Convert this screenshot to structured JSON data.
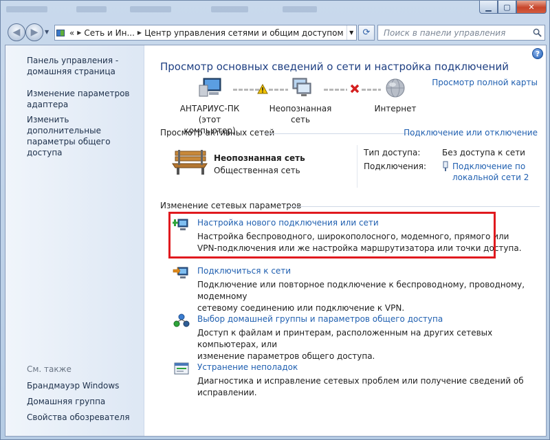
{
  "titlebar": {
    "minimize_icon": "minimize-icon",
    "maximize_icon": "maximize-icon",
    "close_icon": "close-icon"
  },
  "navbar": {
    "breadcrumbs": [
      "«",
      "Сеть и Ин...",
      "Центр управления сетями и общим доступом"
    ],
    "search_placeholder": "Поиск в панели управления"
  },
  "sidebar": {
    "links": [
      "Панель управления - домашняя страница",
      "Изменение параметров адаптера",
      "Изменить дополнительные параметры общего доступа"
    ],
    "see_also_label": "См. также",
    "see_also": [
      "Брандмауэр Windows",
      "Домашняя группа",
      "Свойства обозревателя"
    ]
  },
  "main": {
    "title": "Просмотр основных сведений о сети и настройка подключений",
    "full_map_link": "Просмотр полной карты",
    "map": {
      "computer": "АНТАРИУС-ПК",
      "computer_sub": "(этот компьютер)",
      "network": "Неопознанная сеть",
      "internet": "Интернет"
    },
    "active_networks": {
      "heading": "Просмотр активных сетей",
      "connect_link": "Подключение или отключение",
      "network_name": "Неопознанная сеть",
      "network_type": "Общественная сеть",
      "access_label": "Тип доступа:",
      "access_value": "Без доступа к сети",
      "connections_label": "Подключения:",
      "connection_line1": "Подключение по",
      "connection_line2": "локальной сети 2"
    },
    "change_settings": {
      "heading": "Изменение сетевых параметров",
      "tasks": [
        {
          "title": "Настройка нового подключения или сети",
          "desc1": "Настройка беспроводного, широкополосного, модемного, прямого или",
          "desc2": "VPN-подключения или же настройка маршрутизатора или точки доступа."
        },
        {
          "title": "Подключиться к сети",
          "desc1": "Подключение или повторное подключение к беспроводному, проводному, модемному",
          "desc2": "сетевому соединению или подключение к VPN."
        },
        {
          "title": "Выбор домашней группы и параметров общего доступа",
          "desc1": "Доступ к файлам и принтерам, расположенным на других сетевых компьютерах, или",
          "desc2": "изменение параметров общего доступа."
        },
        {
          "title": "Устранение неполадок",
          "desc1": "Диагностика и исправление сетевых проблем или получение сведений об исправлении.",
          "desc2": ""
        }
      ]
    }
  },
  "colors": {
    "link": "#1f5fb0",
    "title": "#1e3f82",
    "highlight": "#e0191e",
    "warning": "#f2c300",
    "error": "#d41f1f"
  }
}
